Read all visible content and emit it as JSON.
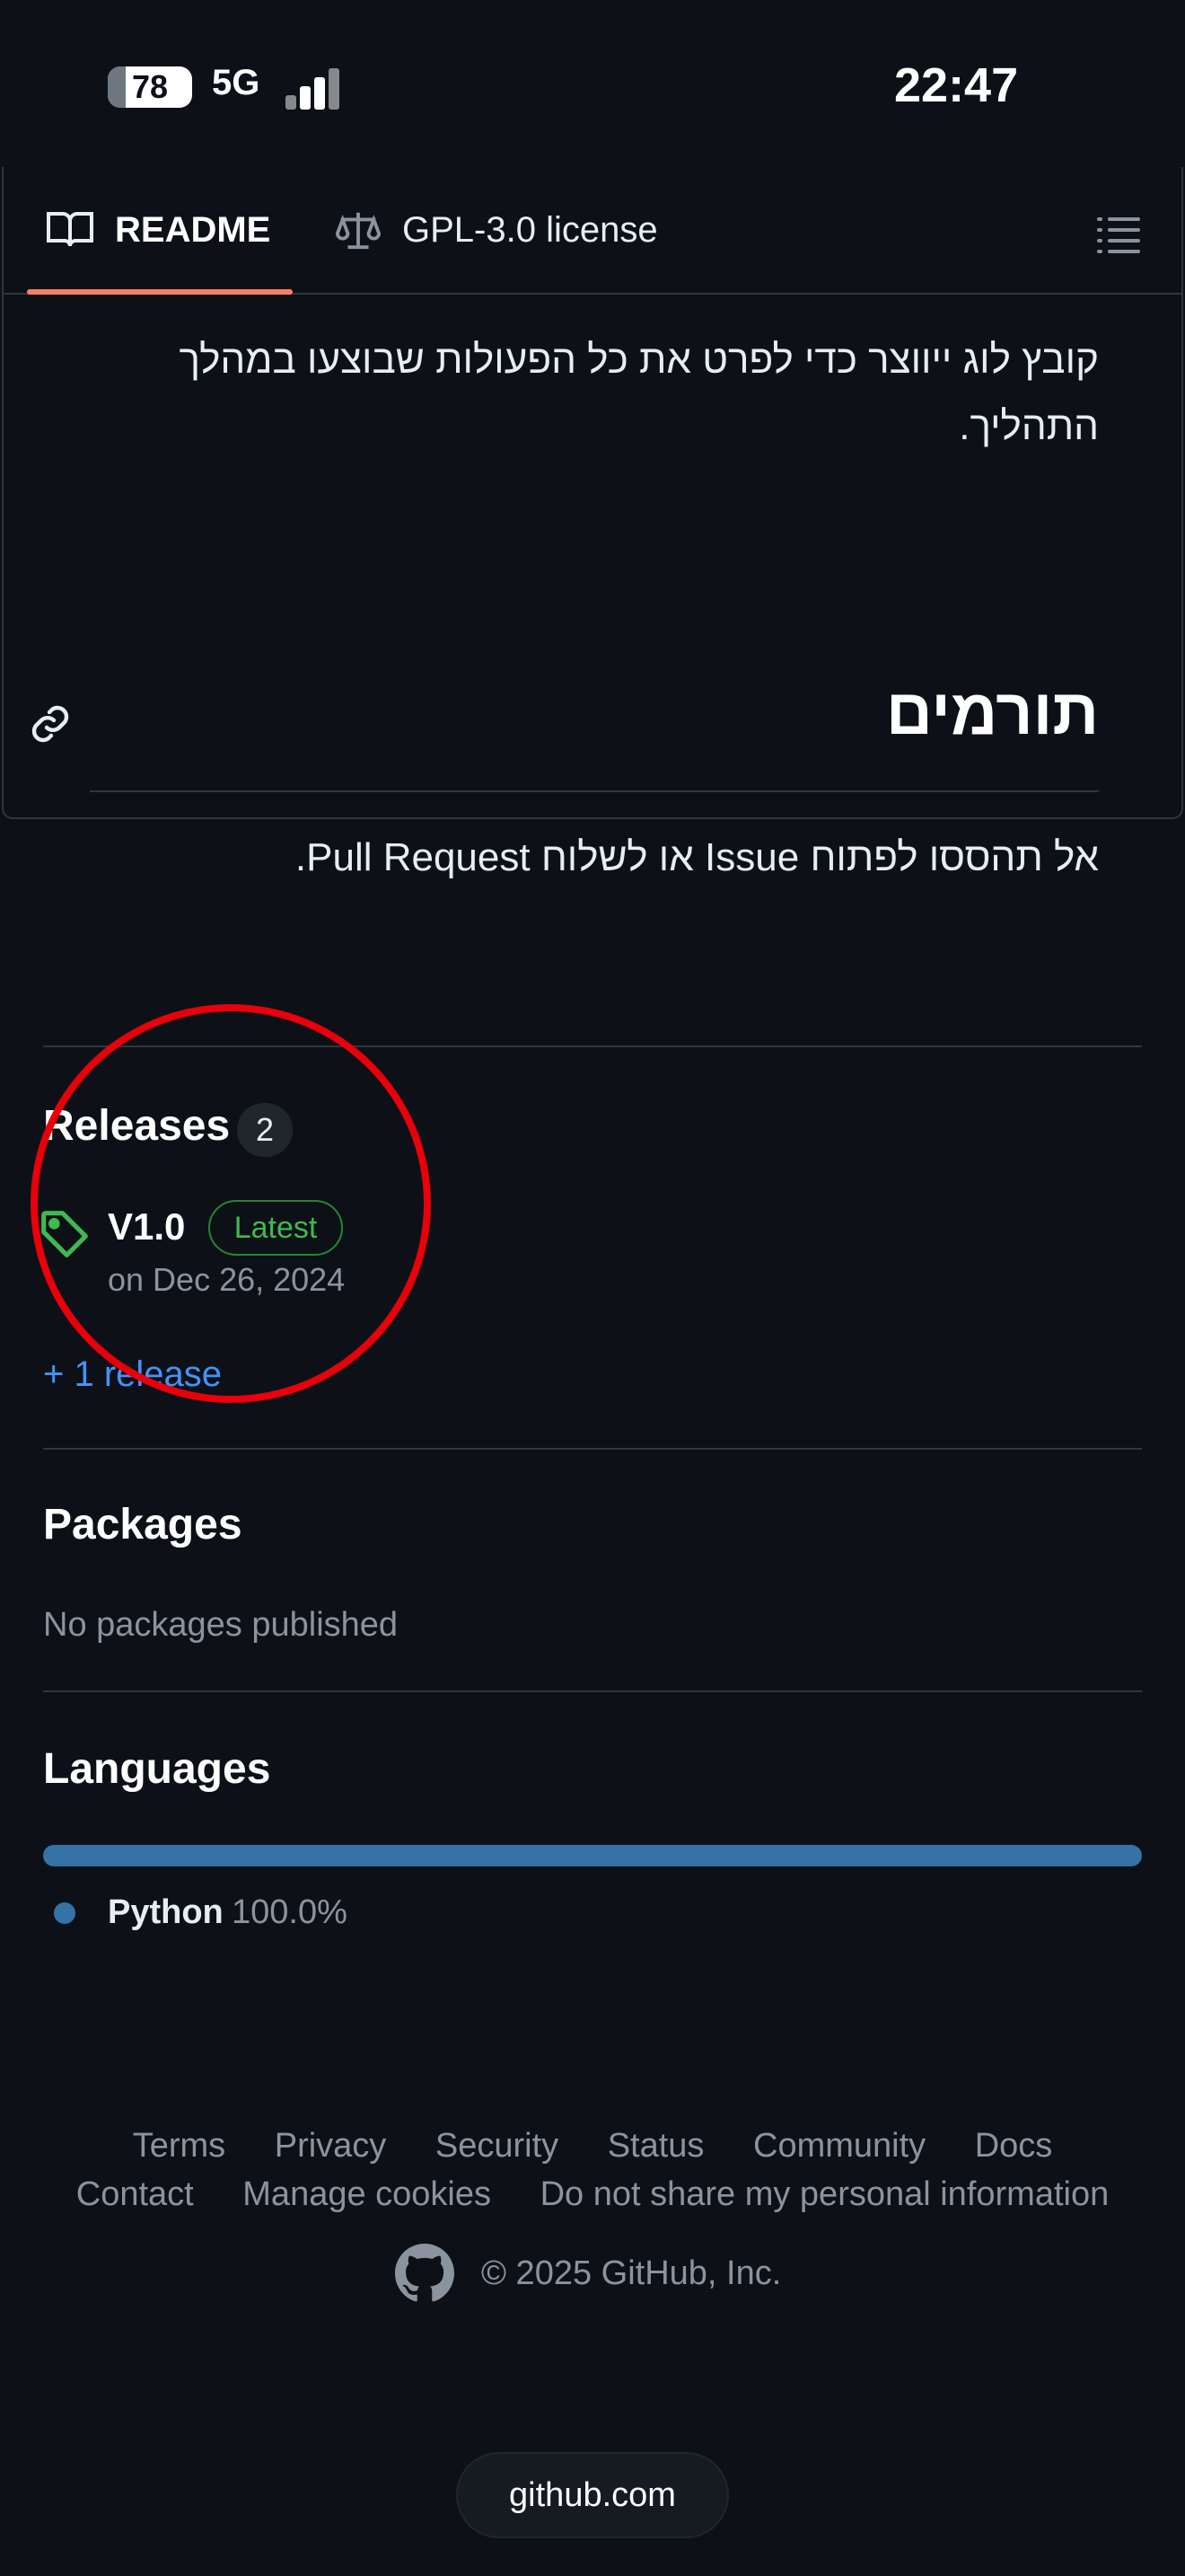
{
  "status_bar": {
    "battery": "78",
    "network": "5G",
    "time": "22:47"
  },
  "readme": {
    "tabs": [
      {
        "label": "README",
        "icon": "book-icon",
        "active": true
      },
      {
        "label": "GPL-3.0 license",
        "icon": "law-scale-icon",
        "active": false
      }
    ],
    "paragraph_1": "קובץ לוג ייווצר כדי לפרט את כל הפעולות שבוצעו במהלך התהליך.",
    "heading": "תורמים",
    "paragraph_2": "אל תהססו לפתוח Issue או לשלוח Pull Request."
  },
  "releases": {
    "title": "Releases",
    "count": "2",
    "latest": {
      "name": "V1.0",
      "badge": "Latest",
      "date": "on Dec 26, 2024"
    },
    "more_link": "+ 1 release"
  },
  "packages": {
    "title": "Packages",
    "empty_text": "No packages published"
  },
  "languages": {
    "title": "Languages",
    "items": [
      {
        "name": "Python",
        "percent": "100.0%",
        "fraction": 1.0,
        "color": "#3572a5"
      }
    ]
  },
  "footer": {
    "links_row_1": [
      "Terms",
      "Privacy",
      "Security",
      "Status",
      "Community",
      "Docs"
    ],
    "links_row_2": [
      "Contact",
      "Manage cookies",
      "Do not share my personal information"
    ],
    "copyright": "© 2025 GitHub, Inc."
  },
  "browser": {
    "url": "github.com"
  },
  "colors": {
    "background": "#0d1117",
    "border": "#30363d",
    "tab_underline": "#f78166",
    "link": "#4493f8",
    "latest_green": "#3fb950",
    "annotation_red": "#e8000b",
    "python": "#3572a5"
  }
}
